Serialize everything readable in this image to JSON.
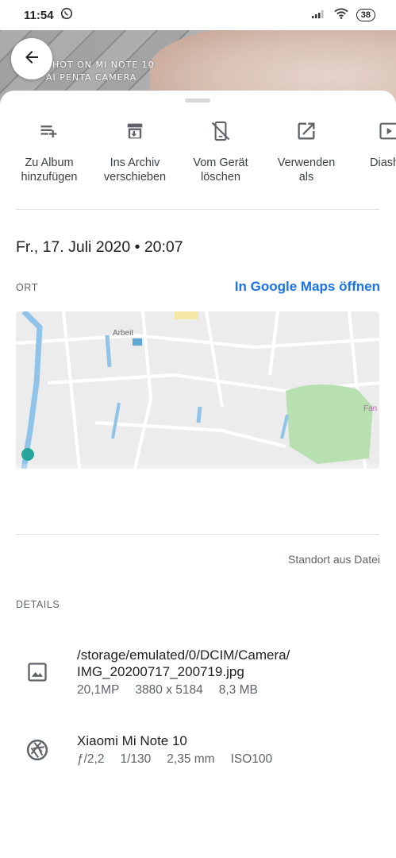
{
  "status_bar": {
    "time": "11:54",
    "battery": "38",
    "icons": [
      "whatsapp-icon",
      "signal-icon",
      "wifi-icon",
      "battery-icon"
    ]
  },
  "photo": {
    "watermark_line1": "SHOT ON MI NOTE 10",
    "watermark_line2": "AI PENTA CAMERA"
  },
  "actions": [
    {
      "label": "Zu Album\nhinzufügen",
      "icon": "playlist-add-icon"
    },
    {
      "label": "Ins Archiv\nverschieben",
      "icon": "archive-icon"
    },
    {
      "label": "Vom Gerät\nlöschen",
      "icon": "delete-from-device-icon"
    },
    {
      "label": "Verwenden\nals",
      "icon": "open-in-new-icon"
    },
    {
      "label": "Diash",
      "icon": "slideshow-icon"
    }
  ],
  "date_time": "Fr., 17. Juli 2020  •  20:07",
  "location": {
    "section_label": "ORT",
    "maps_link": "In Google Maps öffnen",
    "map_labels": [
      "Arbeit",
      "Fan"
    ],
    "source_text": "Standort aus Datei"
  },
  "details": {
    "section_label": "DETAILS",
    "file": {
      "path_line1": "/storage/emulated/0/DCIM/Camera/",
      "path_line2": "IMG_20200717_200719.jpg",
      "megapixels": "20,1MP",
      "resolution": "3880 x 5184",
      "size": "8,3 MB"
    },
    "camera": {
      "model": "Xiaomi Mi Note 10",
      "aperture": "ƒ/2,2",
      "shutter": "1/130",
      "focal_length": "2,35 mm",
      "iso": "ISO100"
    }
  },
  "colors": {
    "link": "#1a73e8",
    "park_green": "#b7dfb0",
    "water_blue": "#8fc3ea"
  }
}
